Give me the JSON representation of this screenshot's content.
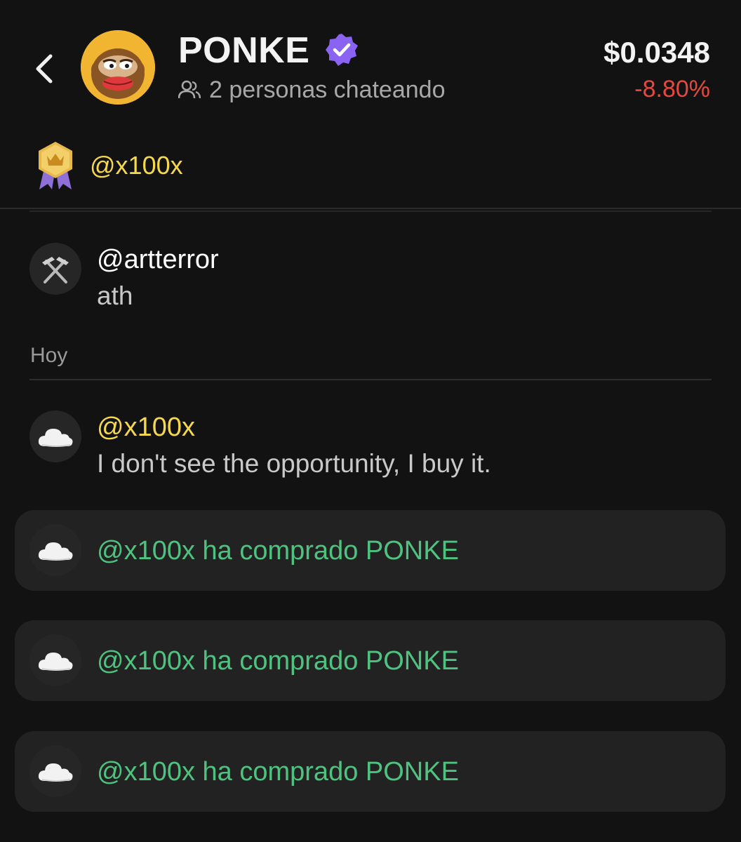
{
  "header": {
    "back_label": "",
    "token_name": "PONKE",
    "chatting_text": "2 personas chateando",
    "price": "$0.0348",
    "price_change": "-8.80%"
  },
  "pinned": {
    "user": "@x100x"
  },
  "messages": [
    {
      "user": "@artterror",
      "text": "ath",
      "avatar_icon": "pickaxe-icon",
      "user_color": "#ffffff"
    },
    {
      "user": "@x100x",
      "text": "I don't see the opportunity, I buy it.",
      "avatar_icon": "cloud-icon",
      "user_color": "#f5d94a"
    }
  ],
  "date_separator": "Hoy",
  "buy_events": [
    {
      "text": "@x100x ha comprado PONKE",
      "avatar_icon": "cloud-icon"
    },
    {
      "text": "@x100x ha comprado PONKE",
      "avatar_icon": "cloud-icon"
    },
    {
      "text": "@x100x ha comprado PONKE",
      "avatar_icon": "cloud-icon"
    }
  ],
  "colors": {
    "background": "#121212",
    "verified": "#8a63f3",
    "negative": "#e34a3f",
    "buy_green": "#4ec37f",
    "pinned_yellow": "#f5d94a"
  }
}
